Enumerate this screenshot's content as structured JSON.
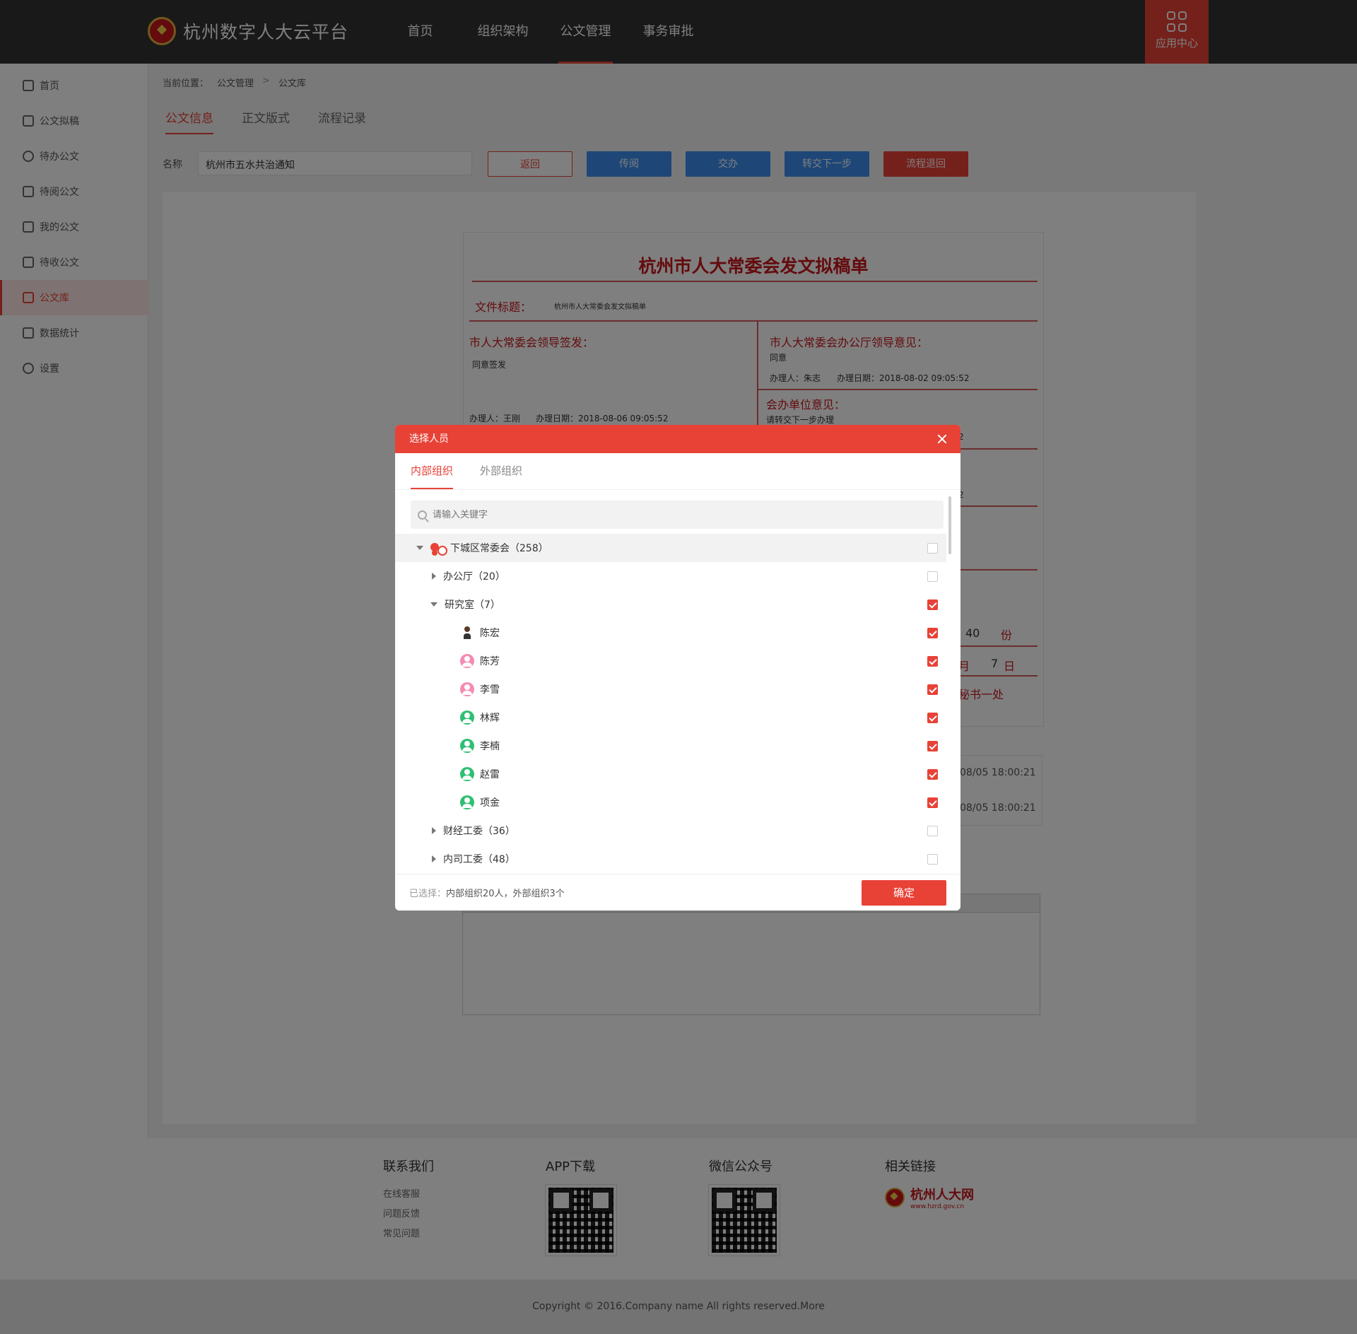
{
  "header": {
    "logo_text": "杭州数字人大云平台",
    "nav": [
      "首页",
      "组织架构",
      "公文管理",
      "事务审批"
    ],
    "active_nav": "公文管理",
    "app_center": "应用中心"
  },
  "sidebar": {
    "items": [
      "首页",
      "公文拟稿",
      "待办公文",
      "待阅公文",
      "我的公文",
      "待收公文",
      "公文库",
      "数据统计",
      "设置"
    ],
    "active": "公文库"
  },
  "breadcrumb": {
    "label": "当前位置：",
    "level1": "公文管理",
    "level2": "公文库",
    "sep": ">"
  },
  "tabs": [
    "公文信息",
    "正文版式",
    "流程记录"
  ],
  "toolbar": {
    "name_label": "名称",
    "name_value": "杭州市五水共治通知",
    "back": "返回",
    "circulate": "传阅",
    "assign": "交办",
    "forward": "转交下一步",
    "return": "流程退回"
  },
  "doc": {
    "title": "杭州市人大常委会发文拟稿单",
    "subject_label": "文件标题：",
    "subject_value": "杭州市人大常委会发文拟稿单",
    "leader_label": "市人大常委会领导签发：",
    "leader_opinion": "同意签发",
    "leader_handler": "办理人：王刚",
    "leader_date": "办理日期：2018-08-06 09:05:52",
    "office_label": "市人大常委会办公厅领导意见：",
    "office_opinion": "同意",
    "office_handler": "办理人：朱志",
    "office_date": "办理日期：2018-08-02 09:05:52",
    "unit_label": "会办单位意见：",
    "unit_opinion": "请转交下一步办理",
    "partial_2a": "2",
    "partial_2b": "2",
    "copies_num": "40",
    "copies_unit": "份",
    "month": "月",
    "day_num": "7",
    "day": "日",
    "office_unit": "秘书一处",
    "log_time_1": "08/05 18:00:21",
    "log_time_2": "08/05 18:00:21"
  },
  "modal": {
    "title": "选择人员",
    "tab_internal": "内部组织",
    "tab_external": "外部组织",
    "search_placeholder": "请输入关键字",
    "root": {
      "name": "下城区常委会（258）",
      "checked": false
    },
    "groups": [
      {
        "name": "办公厅（20）",
        "expanded": false,
        "checked": false
      },
      {
        "name": "研究室（7）",
        "expanded": true,
        "checked": true,
        "members": [
          {
            "name": "陈宏",
            "avatar": "photo-avatar",
            "checked": true
          },
          {
            "name": "陈芳",
            "avatar": "female-avatar-icon",
            "checked": true
          },
          {
            "name": "李雪",
            "avatar": "female-avatar-icon",
            "checked": true
          },
          {
            "name": "林辉",
            "avatar": "male-avatar-icon",
            "checked": true
          },
          {
            "name": "李楠",
            "avatar": "male-avatar-icon",
            "checked": true
          },
          {
            "name": "赵雷",
            "avatar": "male-avatar-icon",
            "checked": true
          },
          {
            "name": "项金",
            "avatar": "male-avatar-icon",
            "checked": true
          }
        ]
      },
      {
        "name": "财经工委（36）",
        "expanded": false,
        "checked": false
      },
      {
        "name": "内司工委（48）",
        "expanded": false,
        "checked": false
      }
    ],
    "selected_label": "已选择：",
    "selected_value": "内部组织20人，外部组织3个",
    "confirm": "确定"
  },
  "footer": {
    "contact_title": "联系我们",
    "contact_links": [
      "在线客服",
      "问题反馈",
      "常见问题"
    ],
    "app_title": "APP下载",
    "wechat_title": "微信公众号",
    "links_title": "相关链接",
    "hzrd_name": "杭州人大网",
    "hzrd_url": "www.hzrd.gov.cn",
    "copyright": "Copyright © 2016.Company name All rights reserved.More"
  },
  "colors": {
    "accent": "#e84237",
    "blue": "#3c8ff0",
    "header": "#333333"
  }
}
